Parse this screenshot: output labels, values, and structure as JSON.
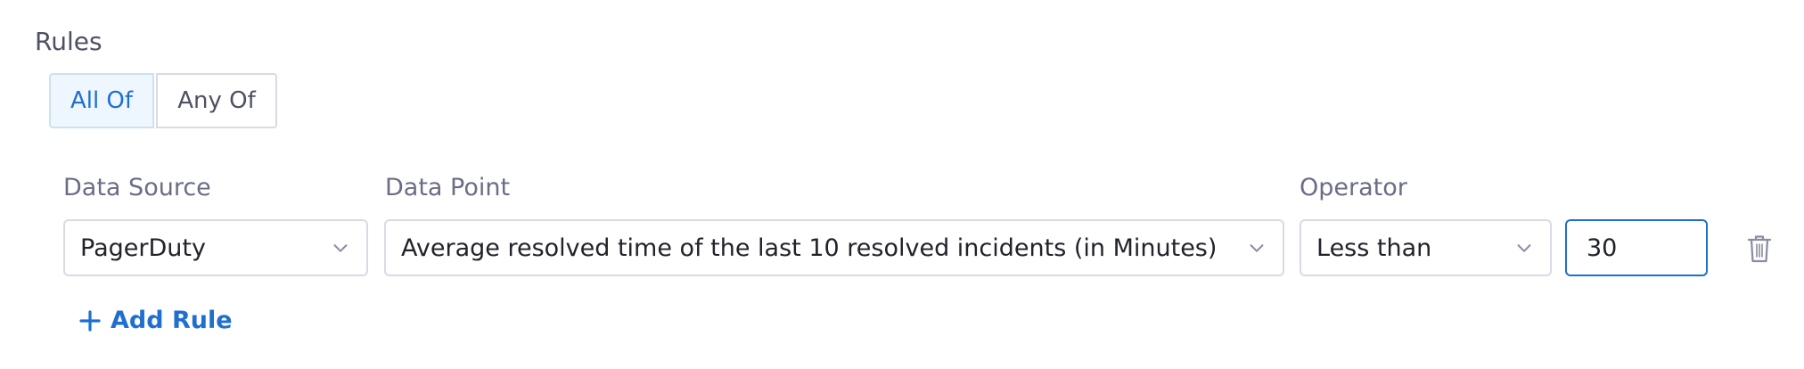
{
  "rules": {
    "title": "Rules",
    "match_toggle": {
      "options": [
        "All Of",
        "Any Of"
      ],
      "selected": "All Of"
    },
    "labels": {
      "data_source": "Data Source",
      "data_point": "Data Point",
      "operator": "Operator"
    },
    "rows": [
      {
        "data_source": "PagerDuty",
        "data_point": "Average resolved time of the last 10 resolved incidents (in Minutes)",
        "operator": "Less than",
        "value": "30"
      }
    ],
    "add_rule_label": "Add Rule"
  },
  "colors": {
    "accent": "#1f6fd1",
    "active_bg": "#eef7ff",
    "border": "#d9dae5",
    "label": "#6b6d85",
    "title": "#4f5162",
    "icon": "#8a8ca0"
  },
  "icons": {
    "dropdown": "chevron-down-icon",
    "delete": "trash-icon",
    "add": "plus-icon"
  }
}
